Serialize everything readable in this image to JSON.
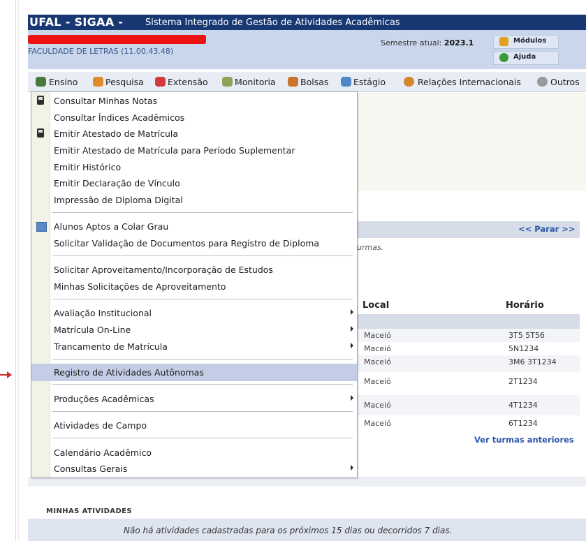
{
  "header": {
    "brand": "UFAL - SIGAA -",
    "system_name": "Sistema Integrado de Gestão de Atividades Acadêmicas",
    "faculdade": "FACULDADE DE LETRAS (11.00.43.48)",
    "semestre_label": "Semestre atual:",
    "semestre_value": "2023.1",
    "modulos_label": "Módulos",
    "ajuda_label": "Ajuda"
  },
  "menubar": {
    "items": [
      {
        "label": "Ensino",
        "icon": "ensino-icon"
      },
      {
        "label": "Pesquisa",
        "icon": "pesquisa-icon"
      },
      {
        "label": "Extensão",
        "icon": "extensao-icon"
      },
      {
        "label": "Monitoria",
        "icon": "monitoria-icon"
      },
      {
        "label": "Bolsas",
        "icon": "bolsas-icon"
      },
      {
        "label": "Estágio",
        "icon": "estagio-icon"
      },
      {
        "label": "Relações Internacionais",
        "icon": "relacoes-icon"
      },
      {
        "label": "Outros",
        "icon": "outros-icon"
      }
    ]
  },
  "dropdown": {
    "items": [
      {
        "label": "Consultar Minhas Notas"
      },
      {
        "label": "Consultar Índices Acadêmicos"
      },
      {
        "label": "Emitir Atestado de Matrícula"
      },
      {
        "label": "Emitir Atestado de Matrícula para Período Suplementar"
      },
      {
        "label": "Emitir Histórico"
      },
      {
        "label": "Emitir Declaração de Vínculo"
      },
      {
        "label": "Impressão de Diploma Digital"
      },
      {
        "label": "Alunos Aptos a Colar Grau"
      },
      {
        "label": "Solicitar Validação de Documentos para Registro de Diploma"
      },
      {
        "label": "Solicitar Aproveitamento/Incorporação de Estudos"
      },
      {
        "label": "Minhas Solicitações de Aproveitamento"
      },
      {
        "label": "Avaliação Institucional"
      },
      {
        "label": "Matrícula On-Line"
      },
      {
        "label": "Trancamento de Matrícula"
      },
      {
        "label": "Registro de Atividades Autônomas"
      },
      {
        "label": "Produções Acadêmicas"
      },
      {
        "label": "Atividades de Campo"
      },
      {
        "label": "Calendário Acadêmico"
      },
      {
        "label": "Consultas Gerais"
      }
    ]
  },
  "turmas_panel": {
    "parar": "<< Parar >>",
    "turmas_text": "urmas.",
    "col_local": "Local",
    "col_horario": "Horário",
    "rows": [
      {
        "local": "Maceió",
        "horario": "3T5 5T56"
      },
      {
        "local": "Maceió",
        "horario": "5N1234"
      },
      {
        "local": "Maceió",
        "horario": "3M6 3T1234"
      },
      {
        "local": "Maceió",
        "horario": "2T1234"
      },
      {
        "local": "Maceió",
        "horario": "4T1234"
      },
      {
        "local": "Maceió",
        "horario": "6T1234"
      }
    ],
    "ver_anteriores": "Ver turmas anteriores"
  },
  "atividades": {
    "title": "Minhas atividades",
    "empty_text": "Não há atividades cadastradas para os próximos 15 dias ou decorridos 7 dias."
  }
}
